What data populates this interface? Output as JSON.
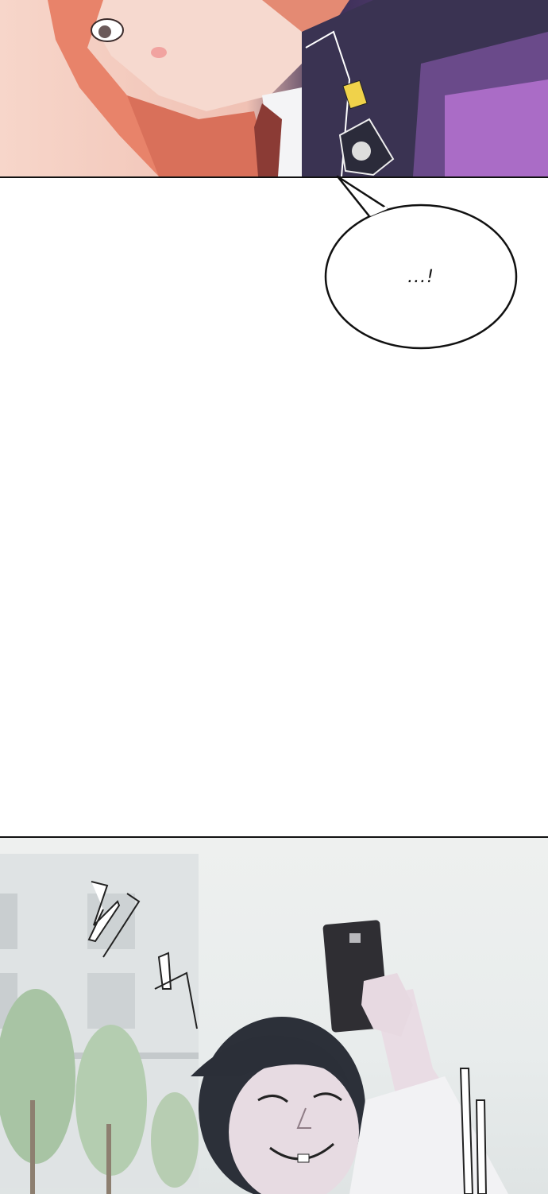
{
  "speech_bubble": {
    "text": "...!"
  }
}
